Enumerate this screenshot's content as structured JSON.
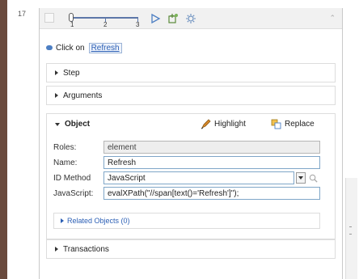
{
  "row_number": "17",
  "slider": {
    "ticks": [
      "1",
      "2",
      "3"
    ],
    "position": 1
  },
  "click_step": {
    "prefix": "Click on",
    "target": "Refresh"
  },
  "sections": {
    "step": "Step",
    "arguments": "Arguments",
    "transactions": "Transactions"
  },
  "object": {
    "title": "Object",
    "highlight_label": "Highlight",
    "replace_label": "Replace",
    "fields": {
      "roles_label": "Roles:",
      "roles_value": "element",
      "name_label": "Name:",
      "name_value": "Refresh",
      "id_method_label": "ID Method",
      "id_method_value": "JavaScript",
      "javascript_label": "JavaScript:",
      "javascript_value": "evalXPath(\"//span[text()='Refresh']\");"
    },
    "related": "Related Objects (0)"
  },
  "icons": {
    "toolbar": [
      "play-icon",
      "capture-icon",
      "settings-icon",
      "chevron-up-icon"
    ],
    "highlight": "highlight-pen-icon",
    "replace": "replace-icon",
    "id_method": "magnifier-icon"
  },
  "colors": {
    "left_bar": "#6a4a3e",
    "link": "#2b5fb5",
    "field_border": "#7fa6c8"
  }
}
